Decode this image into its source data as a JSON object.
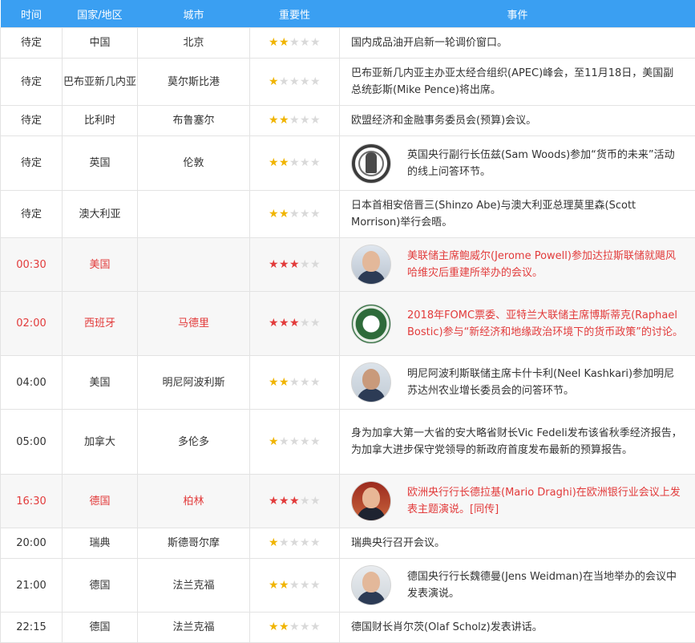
{
  "header": {
    "time": "时间",
    "country": "国家/地区",
    "city": "城市",
    "importance": "重要性",
    "event": "事件"
  },
  "colors": {
    "header_bg": "#3a9ff2",
    "highlight_text": "#e23b3b",
    "highlight_bg": "#f7f7f7",
    "star_normal": "#f0b400",
    "star_important": "#e23b3b",
    "star_off": "#d9d9d9"
  },
  "rows": [
    {
      "time": "待定",
      "country": "中国",
      "city": "北京",
      "stars": 2,
      "highlight": false,
      "avatar": null,
      "event": "国内成品油开启新一轮调价窗口。"
    },
    {
      "time": "待定",
      "country": "巴布亚新几内亚",
      "city": "莫尔斯比港",
      "stars": 1,
      "highlight": false,
      "avatar": null,
      "event": "巴布亚新几内亚主办亚太经合组织(APEC)峰会，至11月18日，美国副总统彭斯(Mike Pence)将出席。"
    },
    {
      "time": "待定",
      "country": "比利时",
      "city": "布鲁塞尔",
      "stars": 2,
      "highlight": false,
      "avatar": null,
      "event": "欧盟经济和金融事务委员会(预算)会议。"
    },
    {
      "time": "待定",
      "country": "英国",
      "city": "伦敦",
      "stars": 2,
      "highlight": false,
      "avatar": "boe-emblem-icon",
      "event": "英国央行副行长伍兹(Sam Woods)参加“货币的未来”活动的线上问答环节。"
    },
    {
      "time": "待定",
      "country": "澳大利亚",
      "city": "",
      "stars": 2,
      "highlight": false,
      "avatar": null,
      "event": "日本首相安倍晋三(Shinzo Abe)与澳大利亚总理莫里森(Scott Morrison)举行会晤。"
    },
    {
      "time": "00:30",
      "country": "美国",
      "city": "",
      "stars": 3,
      "highlight": true,
      "avatar": "powell-portrait",
      "event": "美联储主席鲍威尔(Jerome Powell)参加达拉斯联储就飓风哈维灾后重建所举办的会议。"
    },
    {
      "time": "02:00",
      "country": "西班牙",
      "city": "马德里",
      "stars": 3,
      "highlight": true,
      "avatar": "fed-seal-icon",
      "event": "2018年FOMC票委、亚特兰大联储主席博斯蒂克(Raphael Bostic)参与“新经济和地缘政治环境下的货币政策”的讨论。"
    },
    {
      "time": "04:00",
      "country": "美国",
      "city": "明尼阿波利斯",
      "stars": 2,
      "highlight": false,
      "avatar": "kashkari-portrait",
      "event": "明尼阿波利斯联储主席卡什卡利(Neel Kashkari)参加明尼苏达州农业增长委员会的问答环节。"
    },
    {
      "time": "05:00",
      "country": "加拿大",
      "city": "多伦多",
      "stars": 1,
      "highlight": false,
      "avatar": null,
      "event": "身为加拿大第一大省的安大略省财长Vic Fedeli发布该省秋季经济报告，为加拿大进步保守党领导的新政府首度发布最新的预算报告。"
    },
    {
      "time": "16:30",
      "country": "德国",
      "city": "柏林",
      "stars": 3,
      "highlight": true,
      "avatar": "draghi-portrait",
      "event": "欧洲央行行长德拉基(Mario Draghi)在欧洲银行业会议上发表主题演说。[同传]"
    },
    {
      "time": "20:00",
      "country": "瑞典",
      "city": "斯德哥尔摩",
      "stars": 1,
      "highlight": false,
      "avatar": null,
      "event": "瑞典央行召开会议。"
    },
    {
      "time": "21:00",
      "country": "德国",
      "city": "法兰克福",
      "stars": 2,
      "highlight": false,
      "avatar": "weidman-portrait",
      "event": "德国央行行长魏德曼(Jens Weidman)在当地举办的会议中发表演说。"
    },
    {
      "time": "22:15",
      "country": "德国",
      "city": "法兰克福",
      "stars": 2,
      "highlight": false,
      "avatar": null,
      "event": "德国财长肖尔茨(Olaf Scholz)发表讲话。"
    }
  ]
}
